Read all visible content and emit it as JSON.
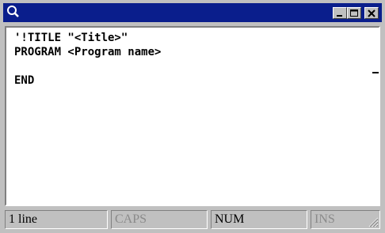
{
  "title_bar": {
    "icon": "magnifier-icon",
    "buttons": [
      "minimize-icon",
      "maximize-icon",
      "close-icon"
    ],
    "color": "#0a1e8c"
  },
  "editor": {
    "lines": [
      "'!TITLE \"<Title>\"",
      "PROGRAM <Program name>",
      "",
      "END"
    ]
  },
  "status_bar": {
    "line_count": "1 line",
    "caps": "CAPS",
    "num": "NUM",
    "ins": "INS",
    "grip": "resize-grip-icon"
  }
}
